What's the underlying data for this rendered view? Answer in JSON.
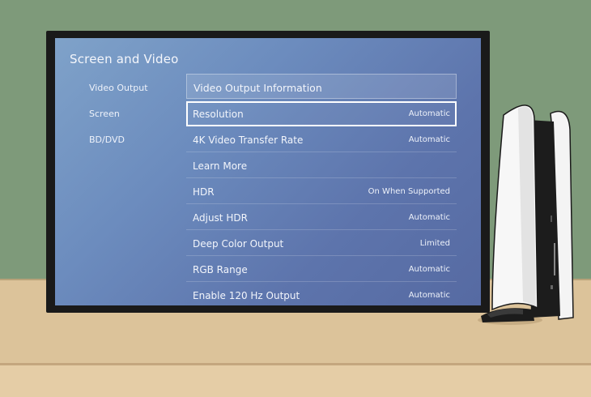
{
  "screen": {
    "title": "Screen and Video",
    "sidebar": [
      {
        "label": "Video Output"
      },
      {
        "label": "Screen"
      },
      {
        "label": "BD/DVD"
      }
    ],
    "list": {
      "header": "Video Output Information",
      "rows": [
        {
          "label": "Resolution",
          "value": "Automatic"
        },
        {
          "label": "4K Video Transfer Rate",
          "value": "Automatic"
        },
        {
          "label": "Learn More",
          "value": ""
        },
        {
          "label": "HDR",
          "value": "On When Supported"
        },
        {
          "label": "Adjust HDR",
          "value": "Automatic"
        },
        {
          "label": "Deep Color Output",
          "value": "Limited"
        },
        {
          "label": "RGB Range",
          "value": "Automatic"
        },
        {
          "label": "Enable 120 Hz Output",
          "value": "Automatic"
        }
      ]
    }
  },
  "colors": {
    "wall": "#7e9a7a",
    "shelf": "#dcc39a",
    "screen_accent": "#5d74ac",
    "selection": "#ffffff"
  },
  "icons": [
    "game-console-icon"
  ]
}
